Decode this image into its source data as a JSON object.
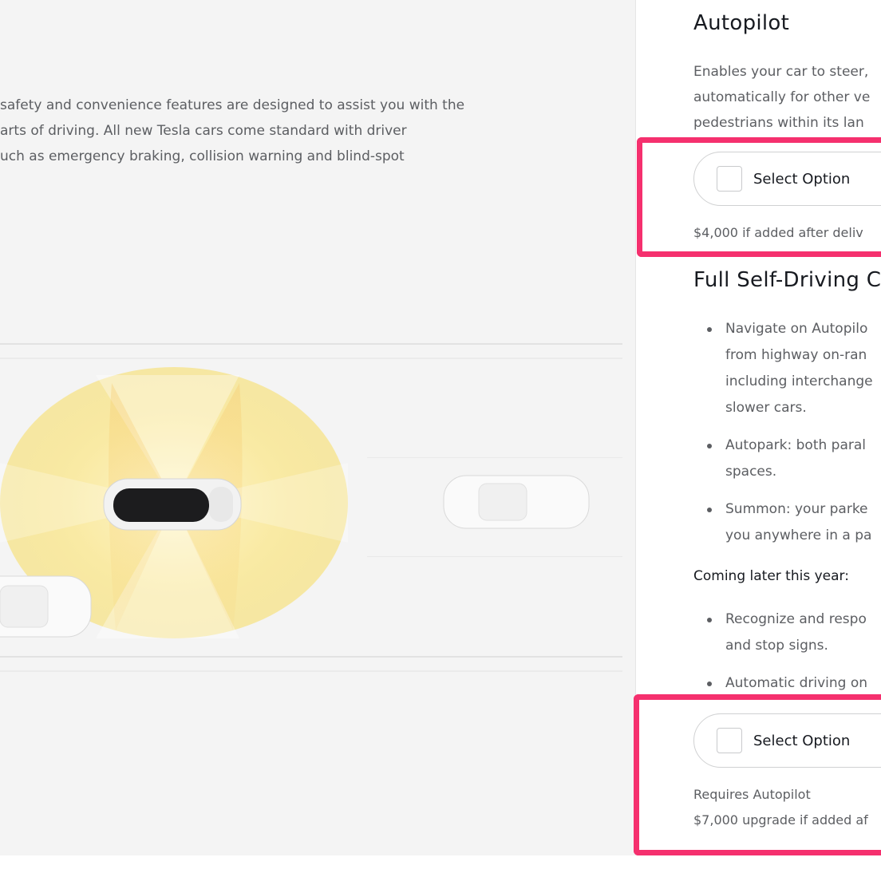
{
  "intro": {
    "lines": [
      "safety and convenience features are designed to assist you with the",
      "arts of driving. All new Tesla cars come standard with driver",
      "uch as emergency braking, collision warning and blind-spot"
    ]
  },
  "autopilot": {
    "title": "Autopilot",
    "description_lines": [
      "Enables your car to steer,",
      "automatically for other ve",
      "pedestrians within its lan"
    ],
    "select_label": "Select Option",
    "price_note": "$4,000 if added after deliv"
  },
  "fsd": {
    "title": "Full Self-Driving C",
    "features": [
      {
        "lines": [
          "Navigate on Autopilo",
          "from highway on-ran",
          "including interchange",
          "slower cars."
        ]
      },
      {
        "lines": [
          "Autopark: both paral",
          "spaces."
        ]
      },
      {
        "lines": [
          "Summon: your parke",
          "you anywhere in a pa"
        ]
      }
    ],
    "coming_later": "Coming later this year:",
    "coming_features": [
      {
        "lines": [
          "Recognize and respo",
          "and stop signs."
        ]
      },
      {
        "lines": [
          "Automatic driving on"
        ]
      }
    ],
    "select_label": "Select Option",
    "requires_note": "Requires Autopilot",
    "price_note": "$7,000 upgrade if added af"
  },
  "colors": {
    "highlight": "#f5306e",
    "background_left": "#f4f4f4",
    "text_muted": "#5c5e62",
    "text_dark": "#171a20"
  }
}
